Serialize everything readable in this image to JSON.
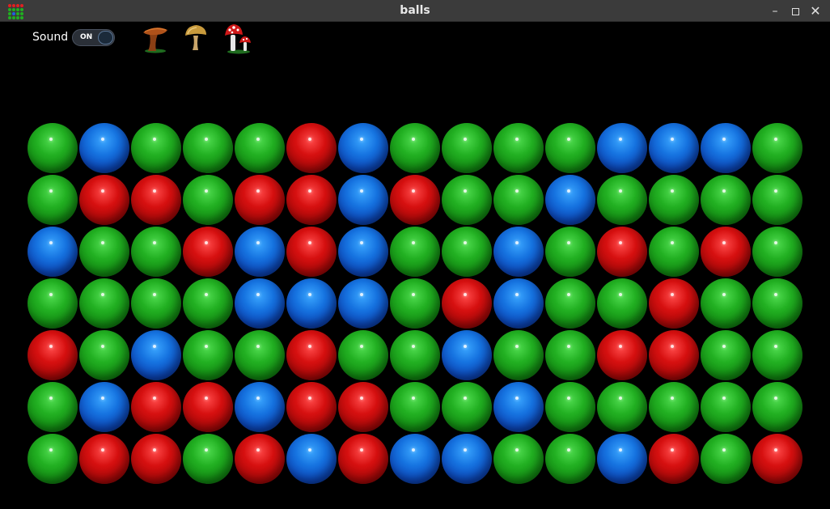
{
  "window": {
    "title": "balls",
    "minimize_glyph": "–",
    "close_glyph": "✕"
  },
  "controls": {
    "sound_label": "Sound",
    "sound_toggle_text": "ON",
    "sound_on": true
  },
  "tools": [
    {
      "name": "mushroom-brown-icon"
    },
    {
      "name": "mushroom-tan-icon"
    },
    {
      "name": "mushroom-red-spotted-icon"
    }
  ],
  "colors": {
    "g": "#22b022",
    "r": "#d61010",
    "b": "#1673e0"
  },
  "board": {
    "rows": 7,
    "cols": 15,
    "cells": [
      [
        "g",
        "b",
        "g",
        "g",
        "g",
        "r",
        "b",
        "g",
        "g",
        "g",
        "g",
        "b",
        "b",
        "b",
        "g"
      ],
      [
        "g",
        "r",
        "r",
        "g",
        "r",
        "r",
        "b",
        "r",
        "g",
        "g",
        "b",
        "g",
        "g",
        "g",
        "g"
      ],
      [
        "b",
        "g",
        "g",
        "r",
        "b",
        "r",
        "b",
        "g",
        "g",
        "b",
        "g",
        "r",
        "g",
        "r",
        "g"
      ],
      [
        "g",
        "g",
        "g",
        "g",
        "b",
        "b",
        "b",
        "g",
        "r",
        "b",
        "g",
        "g",
        "r",
        "g",
        "g"
      ],
      [
        "r",
        "g",
        "b",
        "g",
        "g",
        "r",
        "g",
        "g",
        "b",
        "g",
        "g",
        "r",
        "r",
        "g",
        "g"
      ],
      [
        "g",
        "b",
        "r",
        "r",
        "b",
        "r",
        "r",
        "g",
        "g",
        "b",
        "g",
        "g",
        "g",
        "g",
        "g"
      ],
      [
        "g",
        "r",
        "r",
        "g",
        "r",
        "b",
        "r",
        "b",
        "b",
        "g",
        "g",
        "b",
        "r",
        "g",
        "r"
      ]
    ]
  }
}
